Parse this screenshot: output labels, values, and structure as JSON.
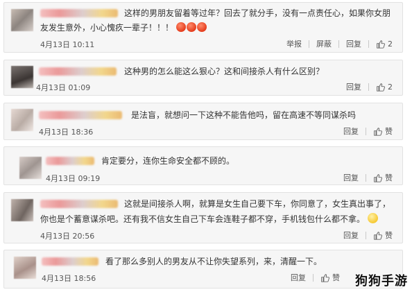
{
  "comments": [
    {
      "text_lines": [
        "这样的男朋友留着等过年？回去了就分手，没有一点责任心，如果你女朋",
        "友发生意外，小心愧疚一辈子！！！"
      ],
      "time": "4月13日 10:11",
      "report": "举报",
      "block": "屏蔽",
      "reply": "回复",
      "likes": "2"
    },
    {
      "text_lines": [
        "这种男的怎么能这么狠心？这和间接杀人有什么区别？"
      ],
      "time": "4月13日 01:09",
      "reply": "回复",
      "likes": "2"
    },
    {
      "text_lines": [
        "是法盲，就想问一下这种不能告他吗，留在高速不等同谋杀吗"
      ],
      "time": "4月13日 18:36",
      "reply": "回复",
      "likes": "赞"
    },
    {
      "text_lines": [
        "肯定要分，连你生命安全都不顾的。"
      ],
      "time": "4月13日 09:19",
      "reply": "回复",
      "likes": "赞"
    },
    {
      "text_lines": [
        "这就是间接杀人啊，就算是女生自己要下车，你同意了，女生真出事了，",
        "你也是个蓄意谋杀吧。还有我不信女生自己下车会连鞋子都不穿，手机钱包什么都不拿。"
      ],
      "time": "4月13日 20:56",
      "reply": "回复",
      "likes": "赞"
    },
    {
      "text_lines": [
        "看了那么多别人的男友从不让你失望系列，来，清醒一下。"
      ],
      "time": "4月13日 18:56",
      "reply": "回复",
      "likes": "赞"
    }
  ],
  "watermark": "狗狗手游",
  "icons": {
    "like": "thumbs-up-icon",
    "emoji_angry": "angry-face-emoji",
    "emoji_smile": "smiling-face-emoji"
  }
}
